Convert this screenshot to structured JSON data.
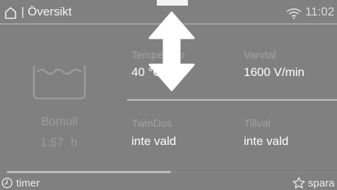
{
  "header": {
    "title": "| Översikt",
    "time": "11:02",
    "icons": {
      "home": "home-icon",
      "wifi": "wifi-icon"
    }
  },
  "program": {
    "icon": "washtub-icon",
    "name": "Bomull",
    "duration_value": "1:57",
    "duration_unit": "h"
  },
  "settings": [
    {
      "label": "Temperatur",
      "value": "40 °C"
    },
    {
      "label": "Varvtal",
      "value": "1600 V/min"
    },
    {
      "label": "TwinDos",
      "value": "inte vald"
    },
    {
      "label": "Tillval",
      "value": "inte vald"
    }
  ],
  "footer": {
    "timer_label": "timer",
    "save_label": "spara",
    "icons": {
      "timer": "clock-icon",
      "save": "star-icon"
    }
  },
  "overlay": {
    "icon": "double-arrow-vertical-icon"
  },
  "colors": {
    "background": "#808080",
    "text": "#ffffff",
    "muted_text": "#a2a2a2",
    "divider": "#c4c4c4"
  }
}
